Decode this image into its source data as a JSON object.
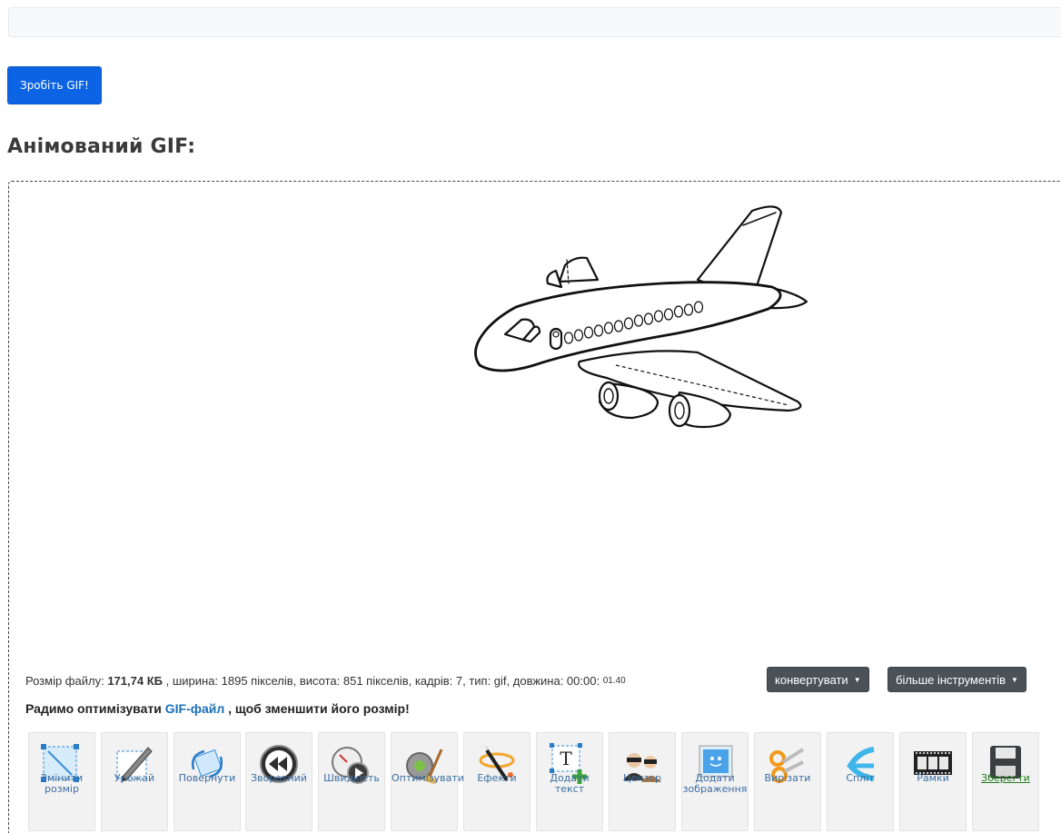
{
  "make_gif_button": "Зробіть GIF!",
  "section_title": "Анімований GIF:",
  "info": {
    "size_label": "Розмір файлу:",
    "size_value": "171,74 КБ",
    "width_text": ", ширина: 1895 пікселів, висота: 851 пікселів, кадрів: 7, тип: gif, довжина: 00:00:",
    "length_small": "01.40"
  },
  "convert_button": "конвертувати",
  "more_tools_button": "більше інструментів",
  "optimize": {
    "prefix": "Радимо оптимізувати",
    "link": "GIF-файл",
    "suffix": ", щоб зменшити його розмір!"
  },
  "tools": [
    {
      "label": "Змінити розмір",
      "icon": "resize-icon"
    },
    {
      "label": "Урожай",
      "icon": "crop-icon"
    },
    {
      "label": "Повернути",
      "icon": "rotate-icon"
    },
    {
      "label": "Зворотний",
      "icon": "rewind-icon"
    },
    {
      "label": "Швидкість",
      "icon": "speed-icon"
    },
    {
      "label": "Оптимізувати",
      "icon": "optimize-icon"
    },
    {
      "label": "Ефекти",
      "icon": "effects-icon"
    },
    {
      "label": "Додати текст",
      "icon": "add-text-icon"
    },
    {
      "label": "Цензор",
      "icon": "censor-icon"
    },
    {
      "label": "Додати зображення",
      "icon": "add-image-icon"
    },
    {
      "label": "Вирізати",
      "icon": "scissors-icon"
    },
    {
      "label": "Спліт",
      "icon": "split-icon"
    },
    {
      "label": "Рамки",
      "icon": "frames-icon"
    },
    {
      "label": "Зберегти",
      "icon": "save-icon"
    }
  ],
  "colors": {
    "primary": "#0c63e4",
    "dark_button": "#4a5258",
    "link": "#1a6fb4",
    "save_link": "#207a1a"
  }
}
